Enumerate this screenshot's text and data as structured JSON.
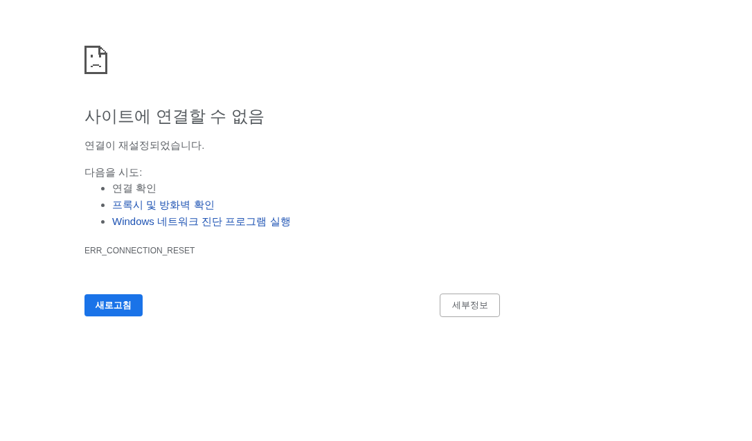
{
  "error_page": {
    "title": "사이트에 연결할 수 없음",
    "message": "연결이 재설정되었습니다.",
    "suggestions_heading": "다음을 시도:",
    "suggestions": [
      {
        "text": "연결 확인",
        "kind": "text"
      },
      {
        "text": "프록시 및 방화벽 확인",
        "kind": "link"
      },
      {
        "text": "Windows 네트워크 진단 프로그램 실행",
        "kind": "link"
      }
    ],
    "error_code": "ERR_CONNECTION_RESET",
    "buttons": [
      {
        "label": "새로고침",
        "kind": "primary"
      },
      {
        "label": "세부정보",
        "kind": "secondary"
      }
    ]
  }
}
